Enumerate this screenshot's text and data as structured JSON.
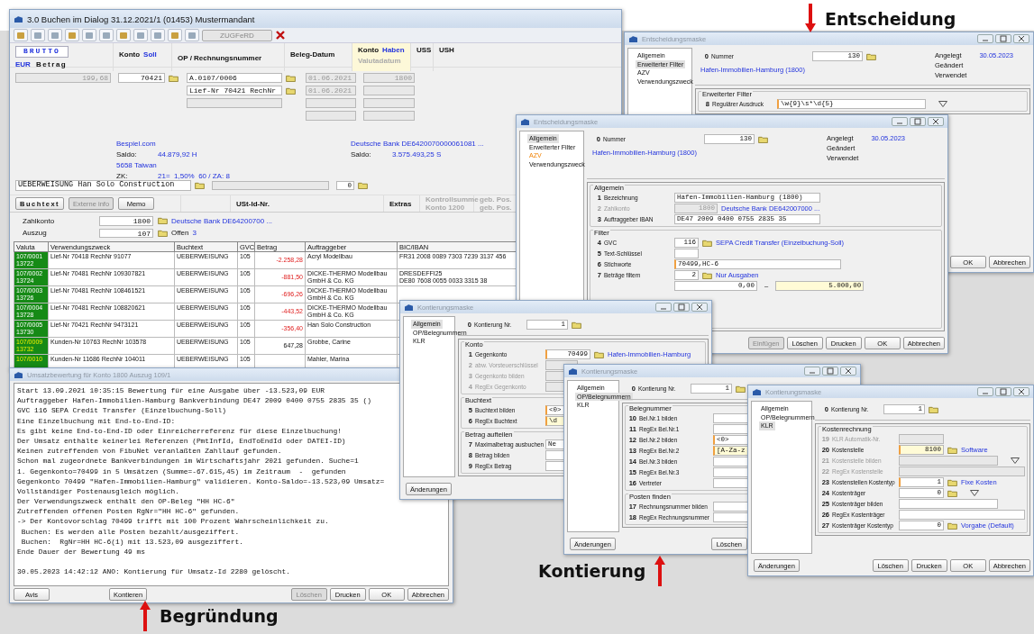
{
  "booking_window": {
    "title": "3.0 Buchen im Dialog 31.12.2021/1 (01453) Mustermandant",
    "toolbar": {
      "button": "ZUGFeRD"
    },
    "header": {
      "brutto": "BRUTTO",
      "currency": "EUR",
      "amount_label": "Betrag",
      "debit_label": "Konto",
      "debit_side": "Soll",
      "op_label": "OP / Rechnungsnummer",
      "date_label": "Beleg-Datum",
      "credit_label": "Konto",
      "credit_side": "Haben",
      "value_date_label": "Valutadatum",
      "uss": "USS",
      "ush": "USH"
    },
    "entry": {
      "amount": "199,68",
      "debit": "70421",
      "op": [
        "A.0107/0006",
        "Lief-Nr 70421 RechNr"
      ],
      "dates": [
        "01.06.2021",
        "01.06.2021"
      ],
      "credit": "1800"
    },
    "debit_info": {
      "name": "Bespiel.com",
      "saldo_label": "Saldo:",
      "saldo": "44.879,92 H",
      "city": "5658 Taiwan",
      "zk_label": "ZK:",
      "zk": "21=  1,50%  60 / ZA: 8"
    },
    "credit_info": {
      "name": "Deutsche Bank DE6420070000061081 ...",
      "saldo_label": "Saldo:",
      "saldo": "3.575.493,25 S"
    },
    "posting_text": "UEBERWEISUNG Han Solo Construction",
    "counter": "0",
    "buttons": [
      {
        "label": "Buchtext",
        "disabled": false
      },
      {
        "label": "Externe info",
        "disabled": true
      },
      {
        "label": "Memo",
        "disabled": false
      }
    ],
    "vat_id_label": "USt-Id-Nr.",
    "extras_label": "Extras",
    "checksum": [
      "Kontrollsumme",
      "Konto  1200"
    ],
    "posted": [
      "geb. Pos.",
      "geb. Pos."
    ],
    "bank": {
      "account_label": "Zahlkonto",
      "account": "1800",
      "account_link": "Deutsche Bank DE64200700 ...",
      "statement_label": "Auszug",
      "statement": "107",
      "open_label": "Offen",
      "open_count": "3"
    },
    "table": {
      "columns": [
        "Valuta",
        "Verwendungszweck",
        "Buchtext",
        "GVC",
        "Betrag",
        "Auftraggeber",
        "BIC/IBAN"
      ],
      "rows": [
        {
          "valuta": [
            "107/0001",
            "13722"
          ],
          "highlighted": false,
          "purpose": "Lief-Nr 70418 RechNr 91077",
          "text": "UEBERWEISUNG",
          "gvc": "105",
          "amount": "-2.258,28",
          "negative": true,
          "payer": [
            "Acryl Modellbau"
          ],
          "bic_iban": [
            "FR31 2008 0089 7303 7239 3137 456"
          ]
        },
        {
          "valuta": [
            "107/0002",
            "13724"
          ],
          "highlighted": false,
          "purpose": "Lief-Nr 70481 RechNr 109307821",
          "text": "UEBERWEISUNG",
          "gvc": "105",
          "amount": "-881,50",
          "negative": true,
          "payer": [
            "DICKE-THERMO Modellbau",
            "GmbH & Co. KG"
          ],
          "bic_iban": [
            "DRESDEFFI25",
            "DE80 7608 0055 0033 3315 38"
          ]
        },
        {
          "valuta": [
            "107/0003",
            "13726"
          ],
          "highlighted": false,
          "purpose": "Lief-Nr 70481 RechNr 108461521",
          "text": "UEBERWEISUNG",
          "gvc": "105",
          "amount": "-696,26",
          "negative": true,
          "payer": [
            "DICKE-THERMO Modellbau",
            "GmbH & Co. KG"
          ]
        },
        {
          "valuta": [
            "107/0004",
            "13728"
          ],
          "highlighted": false,
          "purpose": "Lief-Nr 70481 RechNr 108820621",
          "text": "UEBERWEISUNG",
          "gvc": "105",
          "amount": "-443,52",
          "negative": true,
          "payer": [
            "DICKE-THERMO Modellbau",
            "GmbH & Co. KG"
          ]
        },
        {
          "valuta": [
            "107/0005",
            "13730"
          ],
          "highlighted": false,
          "purpose": "Lief-Nr 70421 RechNr 9473121",
          "text": "UEBERWEISUNG",
          "gvc": "105",
          "amount": "-356,40",
          "negative": true,
          "payer": [
            "Han Solo Construction"
          ]
        },
        {
          "valuta": [
            "107/0009",
            "13732"
          ],
          "highlighted": true,
          "purpose": "Kunden-Nr 10763 RechNr 103578",
          "text": "UEBERWEISUNG",
          "gvc": "105",
          "amount": "647,28",
          "negative": false,
          "payer": [
            "Grobbe, Carine"
          ]
        },
        {
          "valuta": [
            "107/0010"
          ],
          "highlighted": true,
          "purpose": "Kunden-Nr 11686 RechNr 104011",
          "text": "UEBERWEISUNG",
          "gvc": "105",
          "payer": [
            "Mahler, Marina"
          ]
        }
      ]
    }
  },
  "decision_windows": [
    {
      "title": "Entscheidungsmaske",
      "tree": [
        {
          "label": "Allgemein",
          "selected": false,
          "highlighted": false
        },
        {
          "label": "Erweiterter Filter",
          "selected": true,
          "highlighted": false
        },
        {
          "label": "AZV",
          "selected": false,
          "highlighted": false
        },
        {
          "label": "Verwendungszweck",
          "selected": false,
          "highlighted": false
        }
      ],
      "number": {
        "num": "0",
        "label": "Nummer",
        "value": "130"
      },
      "link": "Hafen-Immobilien-Hamburg (1800)",
      "meta": [
        {
          "label": "Angelegt",
          "value": "30.05.2023"
        },
        {
          "label": "Geändert"
        },
        {
          "label": "Verwendet"
        }
      ],
      "groups": [
        {
          "title": "Erweiterter Filter",
          "fields": [
            {
              "num": "8",
              "label": "Regulärer Ausdruck",
              "value": "\\w{9}\\s*\\d{5}",
              "kind": "text",
              "disabled": false,
              "required": true,
              "lookup": false,
              "dropdown": true,
              "highlight": false
            }
          ]
        }
      ],
      "buttons": [
        {
          "label": "OK",
          "disabled": false
        },
        {
          "label": "Abbrechen",
          "disabled": false
        }
      ]
    },
    {
      "title": "Entscheidungsmaske",
      "tree": [
        {
          "label": "Allgemein",
          "selected": true,
          "highlighted": false
        },
        {
          "label": "Erweiterter Filter",
          "selected": false,
          "highlighted": false
        },
        {
          "label": "AZV",
          "selected": false,
          "highlighted": true
        },
        {
          "label": "Verwendungszweck",
          "selected": false,
          "highlighted": false
        }
      ],
      "number": {
        "num": "0",
        "label": "Nummer",
        "value": "130"
      },
      "link": "Hafen-Immobilien-Hamburg (1800)",
      "meta": [
        {
          "label": "Angelegt",
          "value": "30.05.2023"
        },
        {
          "label": "Geändert"
        },
        {
          "label": "Verwendet"
        }
      ],
      "groups": [
        {
          "title": "Allgemein",
          "fields": [
            {
              "num": "1",
              "label": "Bezeichnung",
              "value": "Hafen-Immobilien-Hamburg (1800)",
              "kind": "text",
              "disabled": false,
              "required": false,
              "lookup": false,
              "dropdown": false,
              "highlight": false
            },
            {
              "num": "2",
              "label": "Zahlkonto",
              "value": "1800",
              "kind": "number",
              "disabled": true,
              "required": false,
              "lookup": false,
              "dropdown": false,
              "highlight": false,
              "link": "Deutsche Bank DE642007000 ..."
            },
            {
              "num": "3",
              "label": "Auftraggeber IBAN",
              "value": "DE47 2009 0400 0755 2835 35",
              "kind": "text",
              "disabled": false,
              "required": false,
              "lookup": false,
              "dropdown": false,
              "highlight": false
            }
          ]
        },
        {
          "title": "Filter",
          "fields": [
            {
              "num": "4",
              "label": "GVC",
              "value": "116",
              "kind": "short",
              "disabled": false,
              "required": false,
              "lookup": true,
              "dropdown": false,
              "highlight": false,
              "link": "SEPA Credit Transfer (Einzelbuchung-Soll)"
            },
            {
              "num": "5",
              "label": "Text-Schlüssel",
              "kind": "short",
              "disabled": false,
              "required": false,
              "lookup": false,
              "dropdown": false,
              "highlight": false
            },
            {
              "num": "6",
              "label": "Stichworte",
              "value": "70499,HC-6",
              "kind": "long",
              "disabled": false,
              "required": true,
              "lookup": false,
              "dropdown": false,
              "highlight": false
            },
            {
              "num": "7",
              "label": "Beträge filtern",
              "value": "2",
              "kind": "short",
              "disabled": false,
              "required": false,
              "lookup": true,
              "dropdown": false,
              "highlight": false,
              "link": "Nur Ausgaben"
            }
          ],
          "range": {
            "from": "0,00",
            "separator": "–",
            "to": "5.000,00"
          }
        }
      ],
      "buttons": [
        {
          "label": "Einfügen",
          "disabled": true
        },
        {
          "label": "Löschen",
          "disabled": false
        },
        {
          "label": "Drucken",
          "disabled": false
        },
        {
          "label": "OK",
          "disabled": false
        },
        {
          "label": "Abbrechen",
          "disabled": false
        }
      ]
    }
  ],
  "evaluation_window": {
    "title": "Umsatzbewertung für Konto 1800 Auszug 109/1",
    "log": [
      {
        "lines": [
          "Start 13.09.2021 10:35:15 Bewertung für eine Ausgabe über -13.523,09 EUR",
          "Auftraggeber Hafen-Immobilien-Hamburg Bankverbindung DE47 2009 0400 0755 2835 35 ()",
          "GVC 116 SEPA Credit Transfer (Einzelbuchung-Soll)",
          "Eine Einzelbuchung mit End-to-End-ID:",
          "Es gibt keine End-to-End-ID oder Einreicherreferenz für diese Einzelbuchung!",
          "Der Umsatz enthälte keinerlei Referenzen (PmtInfId, EndToEndId oder DATEI-ID)",
          "Keinen zutreffenden von FibuNet veranlaßten Zahllauf gefunden.",
          "Schon mal zugeordnete Bankverbindungen im Wirtschaftsjahr 2021 gefunden. Suche=1",
          "1. Gegenkonto=70499 in 5 Umsätzen (Summe=-67.615,45) im Zeitraum  -  gefunden",
          "Gegenkonto 70499 \"Hafen-Immobilien-Hamburg\" validieren. Konto-Saldo=-13.523,09 Umsatz=",
          "Vollständiger Postenausgleich möglich.",
          "Der Verwendungszweck enthält den OP-Beleg \"HH HC-6\"",
          "Zutreffenden offenen Posten RgNr=\"HH HC-6\" gefunden.",
          "-> Der Kontovorschlag 70499 trifft mit 100 Prozent Wahrscheinlichkeit zu.",
          " Buchen: Es werden alle Posten bezahlt/ausgeziffert.",
          " Buchen:  RgNr=HH HC-6(1) mit 13.523,09 ausgeziffert.",
          "Ende Dauer der Bewertung 49 ms"
        ]
      },
      {
        "lines": [
          "30.05.2023 14:42:12 ANO: Kontierung für Umsatz-Id 2280 gelöscht."
        ]
      }
    ],
    "buttons": [
      {
        "label": "Avis",
        "disabled": false
      },
      {
        "label": "Kontieren",
        "disabled": false
      },
      {
        "label": "Löschen",
        "disabled": true
      },
      {
        "label": "Drucken",
        "disabled": false
      },
      {
        "label": "OK",
        "disabled": false
      },
      {
        "label": "Abbrechen",
        "disabled": false
      }
    ]
  },
  "assignment_windows": [
    {
      "title": "Kontierungsmaske",
      "tree": [
        {
          "label": "Allgemein",
          "selected": true
        },
        {
          "label": "OP/Belegnummern",
          "selected": false
        },
        {
          "label": "KLR",
          "selected": false
        }
      ],
      "number": {
        "num": "0",
        "label": "Kontierung Nr.",
        "value": "1"
      },
      "groups": [
        {
          "title": "Konto",
          "fields": [
            {
              "num": "1",
              "label": "Gegenkonto",
              "value": "70499",
              "kind": "number",
              "disabled": false,
              "required": true,
              "lookup": true,
              "dropdown": false,
              "highlight": false,
              "link": "Hafen-Immobilien-Hamburg"
            },
            {
              "num": "2",
              "label": "abw. Vorsteuerschlüssel",
              "kind": "short",
              "disabled": true,
              "required": false,
              "lookup": false,
              "dropdown": false,
              "highlight": false
            },
            {
              "num": "3",
              "label": "Gegenkonto bilden",
              "kind": "short",
              "disabled": true,
              "required": false,
              "lookup": false,
              "dropdown": false,
              "highlight": false
            },
            {
              "num": "4",
              "label": "RegEx Gegenkonto",
              "kind": "short",
              "disabled": true,
              "required": false,
              "lookup": false,
              "dropdown": false,
              "highlight": false
            }
          ]
        },
        {
          "title": "Buchtext",
          "fields": [
            {
              "num": "5",
              "label": "Buchtext bilden",
              "value": "<0>",
              "kind": "text",
              "disabled": false,
              "required": true,
              "lookup": false,
              "dropdown": false,
              "highlight": false
            },
            {
              "num": "6",
              "label": "RegEx Buchtext",
              "value": "\\d",
              "kind": "text",
              "disabled": false,
              "required": true,
              "lookup": false,
              "dropdown": false,
              "highlight": true
            }
          ]
        },
        {
          "title": "Betrag aufteilen",
          "fields": [
            {
              "num": "7",
              "label": "Maximalbetrag ausbuchen",
              "value": "Ne",
              "kind": "text",
              "disabled": false,
              "required": false,
              "lookup": false,
              "dropdown": false,
              "highlight": false
            },
            {
              "num": "8",
              "label": "Betrag bilden",
              "kind": "text",
              "disabled": false,
              "required": false,
              "lookup": false,
              "dropdown": false,
              "highlight": false
            },
            {
              "num": "9",
              "label": "RegEx Betrag",
              "kind": "text",
              "disabled": false,
              "required": false,
              "lookup": false,
              "dropdown": false,
              "highlight": false
            }
          ]
        }
      ],
      "buttons": [
        {
          "label": "Änderungen",
          "disabled": false
        }
      ]
    },
    {
      "title": "Kontierungsmaske",
      "tree": [
        {
          "label": "Allgemein",
          "selected": false
        },
        {
          "label": "OP/Belegnummern",
          "selected": true
        },
        {
          "label": "KLR",
          "selected": false
        }
      ],
      "number": {
        "num": "0",
        "label": "Kontierung Nr.",
        "value": "1"
      },
      "groups": [
        {
          "title": "Belegnummer",
          "fields": [
            {
              "num": "10",
              "label": "Bel.Nr.1 bilden",
              "kind": "text",
              "disabled": false,
              "required": false,
              "lookup": false,
              "dropdown": false,
              "highlight": false
            },
            {
              "num": "11",
              "label": "RegEx Bel.Nr.1",
              "kind": "text",
              "disabled": false,
              "required": false,
              "lookup": false,
              "dropdown": false,
              "highlight": false
            },
            {
              "num": "12",
              "label": "Bel.Nr.2 bilden",
              "value": "<0>",
              "kind": "text",
              "disabled": false,
              "required": true,
              "lookup": false,
              "dropdown": false,
              "highlight": false
            },
            {
              "num": "13",
              "label": "RegEx Bel.Nr.2",
              "value": "[A-Za-z",
              "kind": "text",
              "disabled": false,
              "required": true,
              "lookup": false,
              "dropdown": false,
              "highlight": true
            },
            {
              "num": "14",
              "label": "Bel.Nr.3 bilden",
              "kind": "text",
              "disabled": false,
              "required": false,
              "lookup": false,
              "dropdown": false,
              "highlight": false
            },
            {
              "num": "15",
              "label": "RegEx Bel.Nr.3",
              "kind": "text",
              "disabled": false,
              "required": false,
              "lookup": false,
              "dropdown": false,
              "highlight": false
            },
            {
              "num": "16",
              "label": "Vertreter",
              "kind": "text",
              "disabled": false,
              "required": false,
              "lookup": false,
              "dropdown": false,
              "highlight": false
            }
          ]
        },
        {
          "title": "Posten finden",
          "fields": [
            {
              "num": "17",
              "label": "Rechnungsnummer bilden",
              "kind": "text",
              "disabled": false,
              "required": false,
              "lookup": false,
              "dropdown": false,
              "highlight": false
            },
            {
              "num": "18",
              "label": "RegEx Rechnungsnummer",
              "kind": "text",
              "disabled": false,
              "required": false,
              "lookup": false,
              "dropdown": false,
              "highlight": false
            }
          ]
        }
      ],
      "buttons": [
        {
          "label": "Änderungen",
          "disabled": false
        },
        {
          "label": "Löschen",
          "disabled": false
        }
      ]
    },
    {
      "title": "Kontierungsmaske",
      "tree": [
        {
          "label": "Allgemein",
          "selected": false
        },
        {
          "label": "OP/Belegnummern",
          "selected": false
        },
        {
          "label": "KLR",
          "selected": true
        }
      ],
      "number": {
        "num": "0",
        "label": "Kontierung Nr.",
        "value": "1"
      },
      "groups": [
        {
          "title": "Kostenrechnung",
          "fields": [
            {
              "num": "19",
              "label": "KLR Automatik-Nr.",
              "kind": "number",
              "disabled": true,
              "required": false,
              "lookup": false,
              "dropdown": false,
              "highlight": false
            },
            {
              "num": "20",
              "label": "Kostenstelle",
              "value": "8100",
              "kind": "number",
              "disabled": false,
              "required": true,
              "lookup": true,
              "dropdown": false,
              "highlight": true,
              "link": "Software"
            },
            {
              "num": "21",
              "label": "Kostenstelle bilden",
              "kind": "text",
              "disabled": true,
              "required": false,
              "lookup": false,
              "dropdown": true,
              "highlight": false
            },
            {
              "num": "22",
              "label": "RegEx Kostenstelle",
              "kind": "long",
              "disabled": true,
              "required": false,
              "lookup": false,
              "dropdown": false,
              "highlight": false
            },
            {
              "num": "23",
              "label": "Kostenstellen Kostentyp",
              "value": "1",
              "kind": "number",
              "disabled": false,
              "required": true,
              "lookup": true,
              "dropdown": false,
              "highlight": false,
              "link": "Fixe Kosten"
            },
            {
              "num": "24",
              "label": "Kostenträger",
              "value": "0",
              "kind": "number",
              "disabled": false,
              "required": false,
              "lookup": true,
              "dropdown": true,
              "highlight": false
            },
            {
              "num": "25",
              "label": "Kostenträger bilden",
              "kind": "text",
              "disabled": false,
              "required": false,
              "lookup": false,
              "dropdown": false,
              "highlight": false
            },
            {
              "num": "26",
              "label": "RegEx Kostenträger",
              "kind": "long",
              "disabled": false,
              "required": false,
              "lookup": false,
              "dropdown": false,
              "highlight": false
            },
            {
              "num": "27",
              "label": "Kostenträger Kostentyp",
              "value": "0",
              "kind": "number",
              "disabled": false,
              "required": false,
              "lookup": true,
              "dropdown": false,
              "highlight": false,
              "link": "Vorgabe (Default)"
            }
          ]
        }
      ],
      "buttons": [
        {
          "label": "Änderungen",
          "disabled": false
        },
        {
          "label": "Löschen",
          "disabled": false
        },
        {
          "label": "Drucken",
          "disabled": false
        },
        {
          "label": "OK",
          "disabled": false
        },
        {
          "label": "Abbrechen",
          "disabled": false
        }
      ]
    }
  ],
  "annotations": [
    {
      "text": "Entscheidung"
    },
    {
      "text": "Kontierung"
    },
    {
      "text": "Begründung"
    }
  ]
}
